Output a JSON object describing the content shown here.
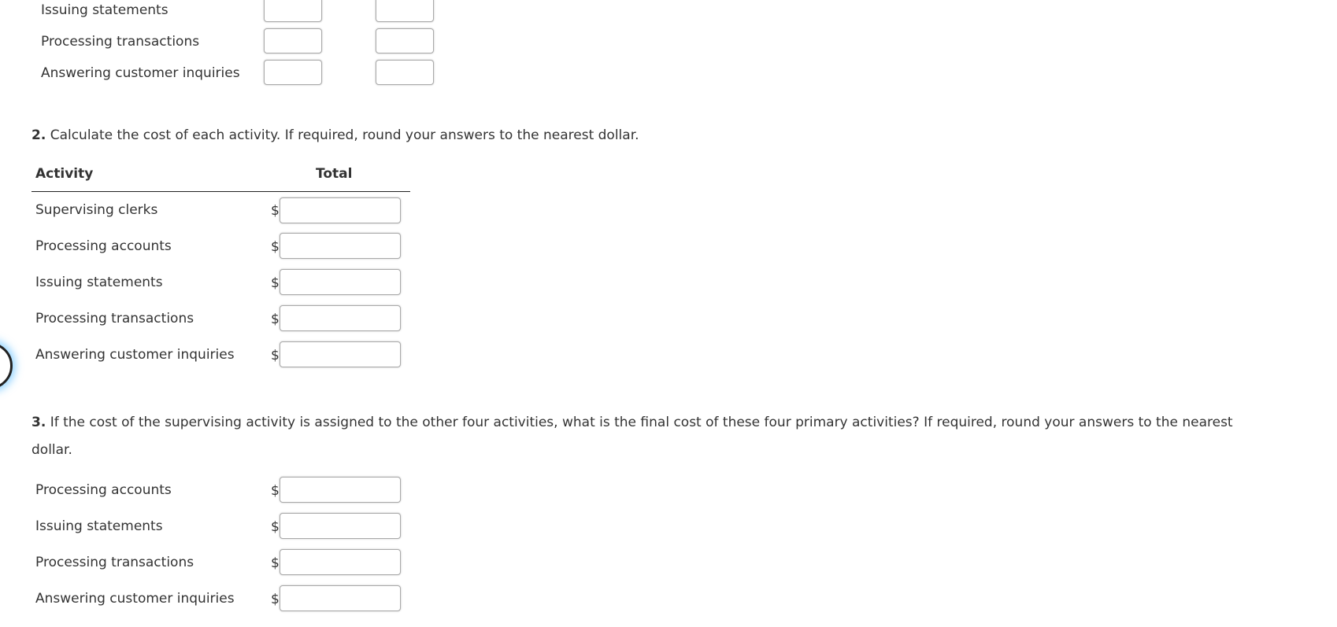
{
  "part1": {
    "rows": [
      {
        "label": "Issuing statements"
      },
      {
        "label": "Processing transactions"
      },
      {
        "label": "Answering customer inquiries"
      }
    ],
    "col1_values": [
      "",
      "",
      ""
    ],
    "col2_values": [
      "",
      "",
      ""
    ]
  },
  "part2": {
    "number": "2.",
    "instruction": "Calculate the cost of each activity. If required, round your answers to the nearest dollar.",
    "header": {
      "activity": "Activity",
      "total": "Total"
    },
    "currency_symbol": "$",
    "rows": [
      {
        "label": "Supervising clerks",
        "value": ""
      },
      {
        "label": "Processing accounts",
        "value": ""
      },
      {
        "label": "Issuing statements",
        "value": ""
      },
      {
        "label": "Processing transactions",
        "value": ""
      },
      {
        "label": "Answering customer inquiries",
        "value": ""
      }
    ]
  },
  "part3": {
    "number": "3.",
    "instruction_line1": "If the cost of the supervising activity is assigned to the other four activities, what is the final cost of these four primary activities? If required, round your answers to the nearest",
    "instruction_line2": "dollar.",
    "currency_symbol": "$",
    "rows": [
      {
        "label": "Processing accounts",
        "value": ""
      },
      {
        "label": "Issuing statements",
        "value": ""
      },
      {
        "label": "Processing transactions",
        "value": ""
      },
      {
        "label": "Answering customer inquiries",
        "value": ""
      }
    ]
  }
}
